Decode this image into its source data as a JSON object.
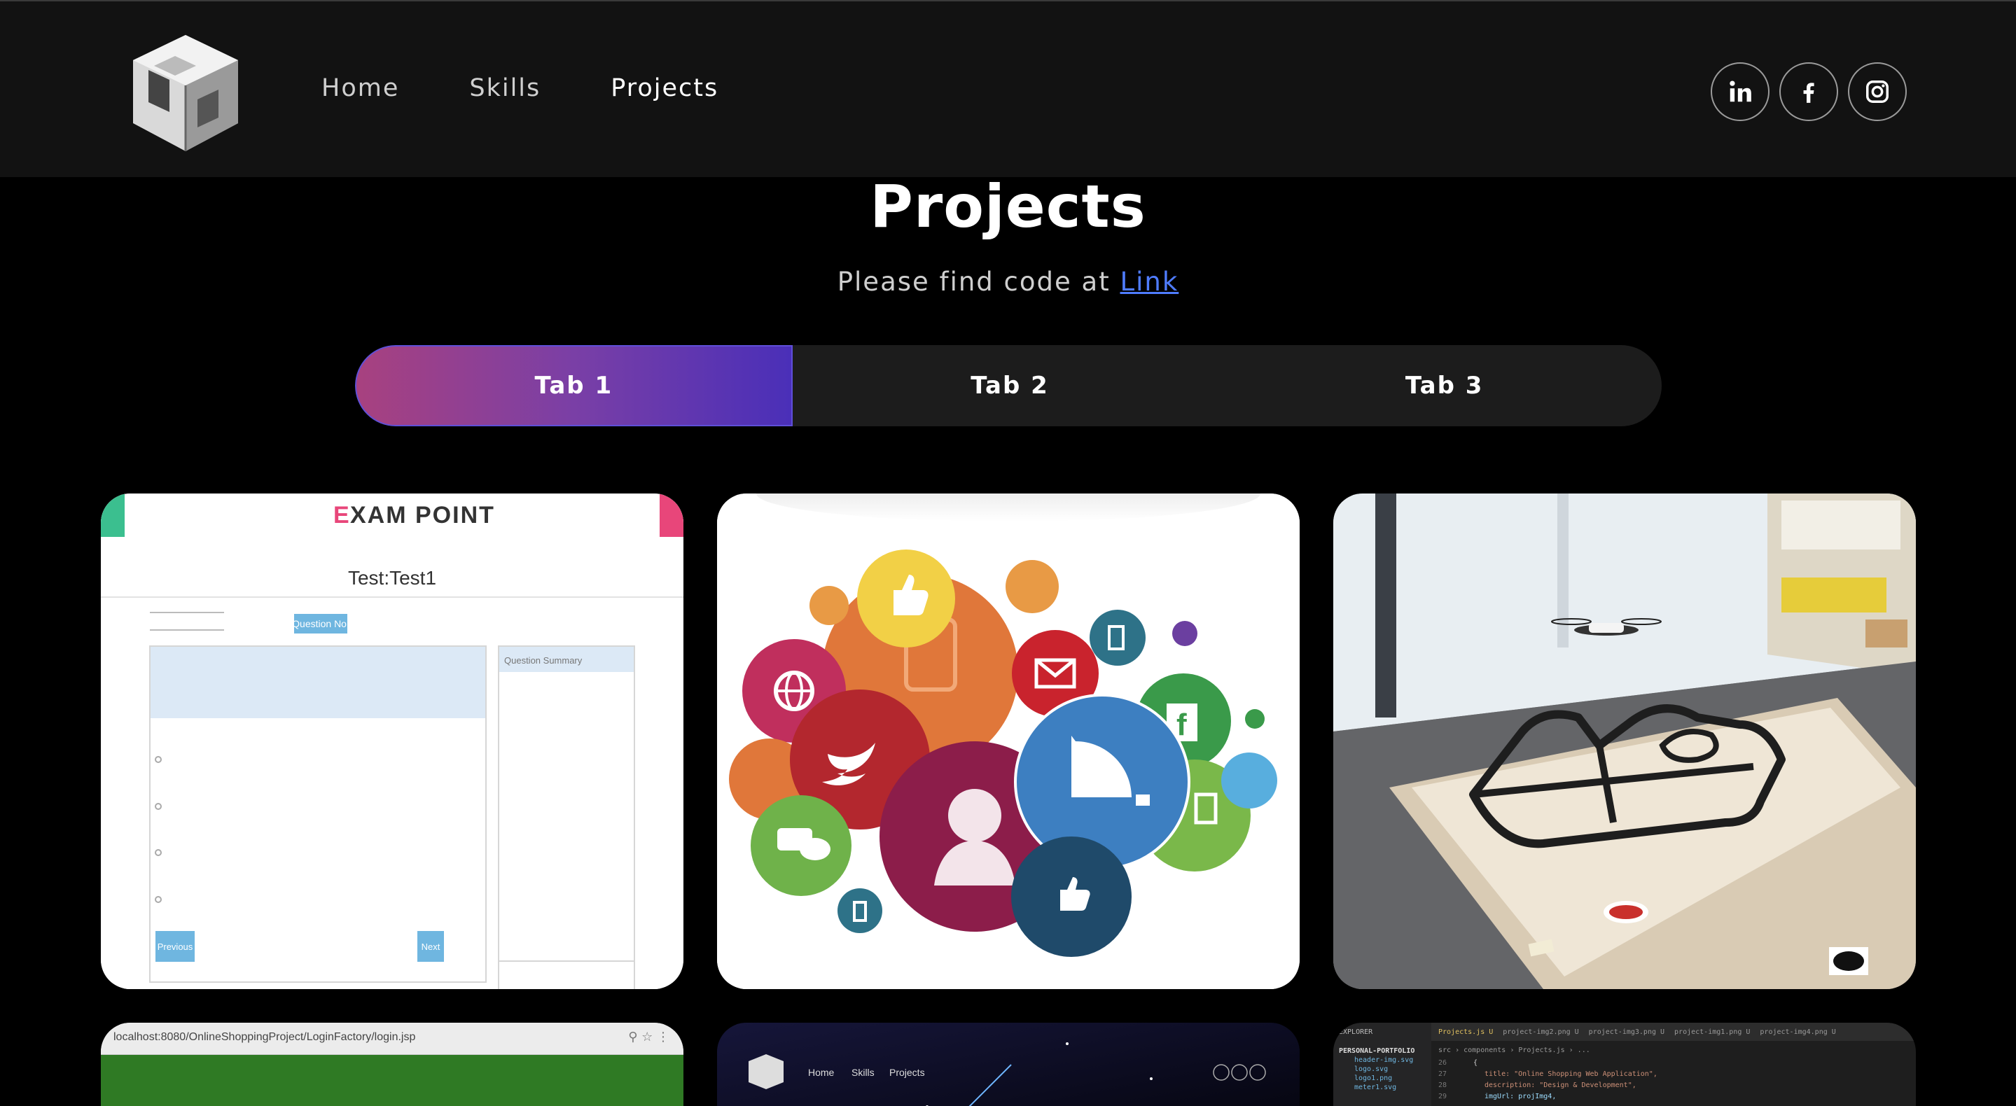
{
  "nav": {
    "links": [
      "Home",
      "Skills",
      "Projects"
    ],
    "active": "Projects",
    "socials": [
      "linkedin-icon",
      "facebook-icon",
      "instagram-icon"
    ]
  },
  "header": {
    "title": "Projects",
    "subtitle_prefix": "Please find code at ",
    "subtitle_link": "Link"
  },
  "tabs": {
    "items": [
      "Tab 1",
      "Tab 2",
      "Tab 3"
    ],
    "active": "Tab 1"
  },
  "cards": {
    "exam": {
      "brand_e": "E",
      "brand_rest": "XAM POINT",
      "test_title": "Test:Test1",
      "question_no": "Question No:",
      "question_summary": "Question Summary",
      "prev": "Previous",
      "next": "Next"
    },
    "shop": {
      "url": "localhost:8080/OnlineShoppingProject/LoginFactory/login.jsp"
    },
    "portfolio": {
      "links": [
        "Home",
        "Skills",
        "Projects"
      ]
    },
    "code": {
      "explorer": "EXPLORER",
      "project": "PERSONAL-PORTFOLIO",
      "tabs": [
        "Projects.js U",
        "project-img2.png U",
        "project-img3.png U",
        "project-img1.png U",
        "project-img4.png U"
      ],
      "breadcrumb": "src › components › Projects.js › ...",
      "files": [
        "header-img.svg",
        "logo.svg",
        "logo1.png",
        "meter1.svg"
      ],
      "line_numbers": [
        "26",
        "27",
        "28",
        "29"
      ],
      "lines": [
        "{",
        "title: \"Online Shopping Web Application\",",
        "description: \"Design & Development\",",
        "imgUrl: projImg4,"
      ]
    }
  }
}
